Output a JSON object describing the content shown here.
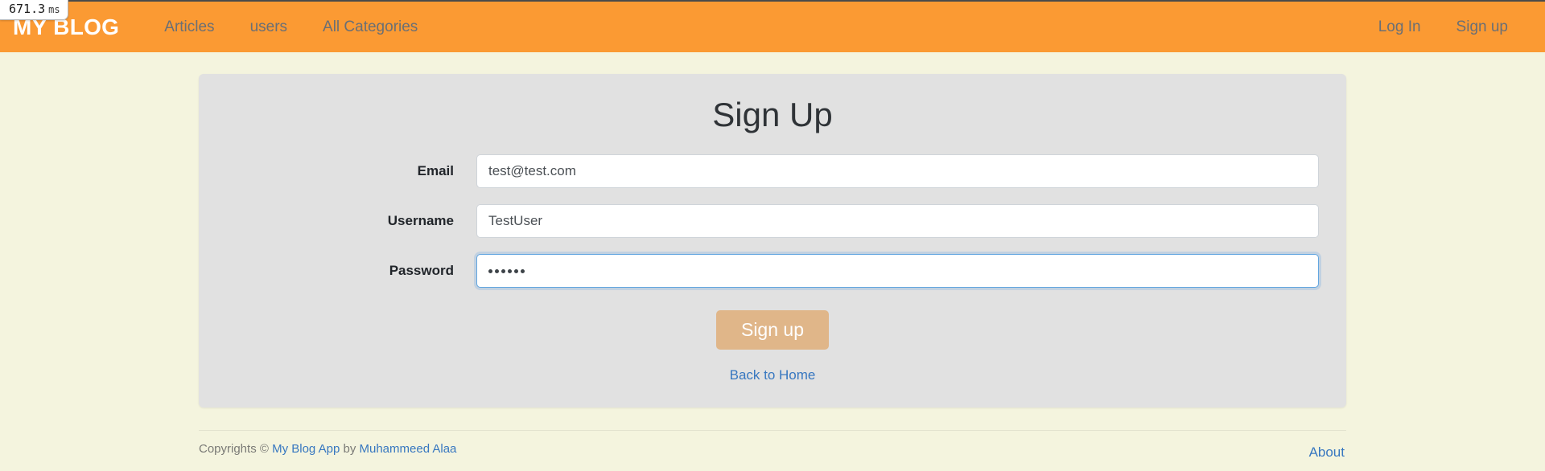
{
  "overlay": {
    "timing_value": "671.3",
    "timing_unit": "ms"
  },
  "navbar": {
    "brand": "MY BLOG",
    "background_color": "#fb9a33",
    "links": [
      {
        "label": "Articles",
        "name": "nav-link-articles"
      },
      {
        "label": "users",
        "name": "nav-link-users"
      },
      {
        "label": "All Categories",
        "name": "nav-link-all-categories"
      }
    ],
    "right_links": [
      {
        "label": "Log In",
        "name": "nav-link-login"
      },
      {
        "label": "Sign up",
        "name": "nav-link-signup"
      }
    ]
  },
  "card": {
    "title": "Sign Up",
    "background_color": "#e1e1e1",
    "fields": [
      {
        "label": "Email",
        "value": "test@test.com",
        "placeholder": "Email",
        "type": "text",
        "focused": false
      },
      {
        "label": "Username",
        "value": "TestUser",
        "placeholder": "Username",
        "type": "text",
        "focused": false
      },
      {
        "label": "Password",
        "value": "••••••",
        "masked_char_count": 6,
        "placeholder": "Password",
        "type": "password",
        "focused": true
      }
    ],
    "submit_label": "Sign up",
    "submit_color": "#e0b689",
    "back_link": "Back to Home"
  },
  "footer": {
    "copyright_prefix": "Copyrights © ",
    "app_link": "My Blog App",
    "by_text": " by ",
    "author_link": "Muhammeed Alaa",
    "about_label": "About",
    "link_color": "#3777c0"
  }
}
